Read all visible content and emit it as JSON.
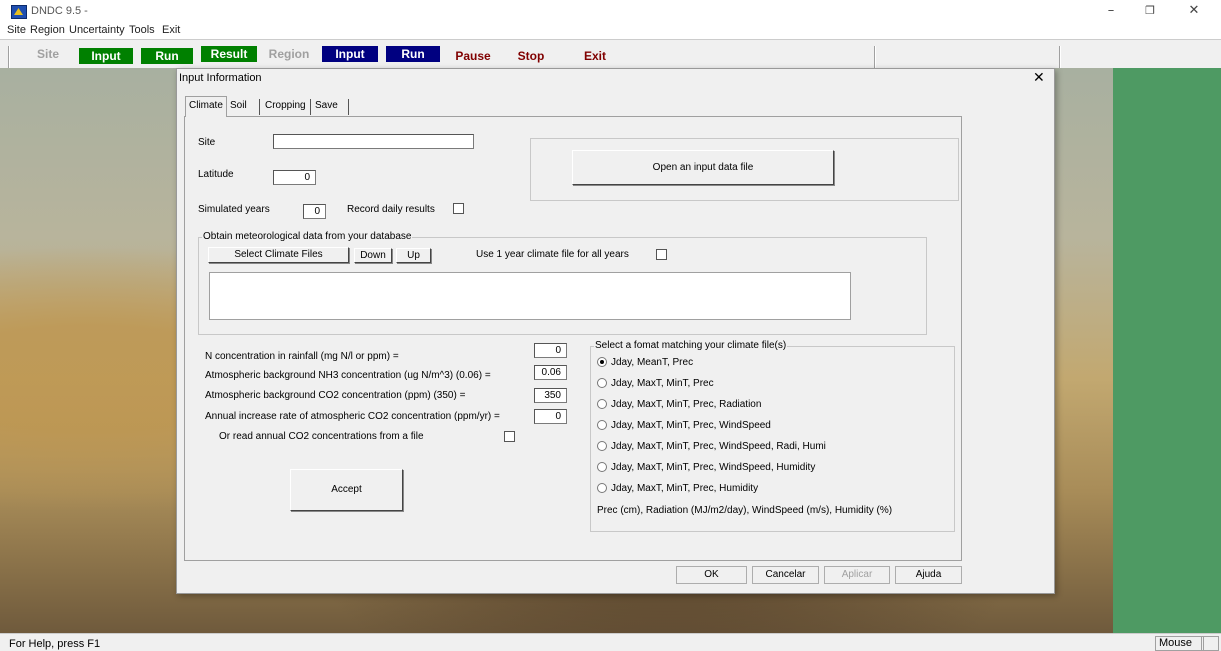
{
  "app": {
    "title": "DNDC 9.5 -"
  },
  "menu": [
    "Site",
    "Region",
    "Uncertainty",
    "Tools",
    "Exit"
  ],
  "toolbar": {
    "site": "Site",
    "input1": "Input",
    "run1": "Run",
    "result": "Result",
    "region": "Region",
    "input2": "Input",
    "run2": "Run",
    "pause": "Pause",
    "stop": "Stop",
    "exit": "Exit"
  },
  "colors": {
    "green": "#008000",
    "navy": "#000080",
    "maroon": "#800000",
    "side_panel": "#4e9a63"
  },
  "dialog": {
    "title": "Input Information",
    "tabs": [
      "Climate",
      "Soil",
      "Cropping",
      "Save"
    ],
    "site_label": "Site",
    "site_value": "",
    "latitude_label": "Latitude",
    "latitude_value": "0",
    "simyears_label": "Simulated years",
    "simyears_value": "0",
    "record_daily_label": "Record daily results",
    "open_file_button": "Open an input data file",
    "met_group_label": "Obtain meteorological data from your database",
    "select_climate_button": "Select Climate Files",
    "down_button": "Down",
    "up_button": "Up",
    "one_year_label": "Use 1 year climate file for all years",
    "n_rain_label": "N concentration in rainfall (mg N/l or ppm) =",
    "n_rain_value": "0",
    "nh3_label": "Atmospheric background NH3 concentration (ug N/m^3)  (0.06) =",
    "nh3_value": "0.06",
    "co2_label": "Atmospheric background CO2 concentration (ppm)  (350) =",
    "co2_value": "350",
    "co2_rate_label": "Annual increase rate of atmospheric CO2 concentration (ppm/yr)  =",
    "co2_rate_value": "0",
    "co2_file_label": "Or read annual CO2 concentrations from a file",
    "accept_button": "Accept",
    "format_group_label": "Select a fomat matching your climate file(s)",
    "formats": [
      "Jday, MeanT, Prec",
      "Jday, MaxT, MinT, Prec",
      "Jday, MaxT, MinT, Prec, Radiation",
      "Jday, MaxT, MinT, Prec, WindSpeed",
      "Jday, MaxT, MinT, Prec, WindSpeed, Radi, Humi",
      "Jday, MaxT, MinT, Prec, WindSpeed, Humidity",
      "Jday, MaxT, MinT, Prec, Humidity"
    ],
    "units_note": "Prec (cm), Radiation (MJ/m2/day), WindSpeed (m/s), Humidity (%)",
    "ok_button": "OK",
    "cancel_button": "Cancelar",
    "apply_button": "Aplicar",
    "help_button": "Ajuda"
  },
  "status": {
    "help": "For Help, press F1",
    "mouse": "Mouse"
  }
}
